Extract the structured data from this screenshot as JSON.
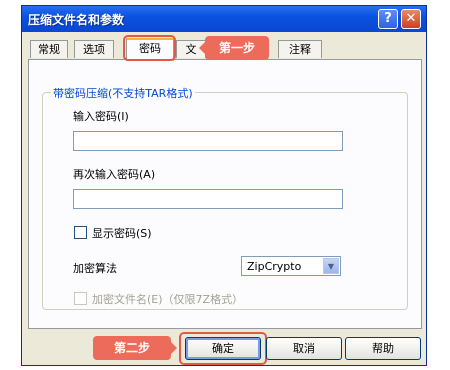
{
  "window": {
    "title": "压缩文件名和参数",
    "help_label": "?",
    "close_label": "✕"
  },
  "tabs": [
    {
      "label": "常规"
    },
    {
      "label": "选项"
    },
    {
      "label": "密码"
    },
    {
      "label": "文"
    },
    {
      "label": "注释"
    }
  ],
  "group": {
    "title": "带密码压缩(不支持TAR格式)",
    "password_label": "输入密码(I)",
    "password_value": "",
    "confirm_label": "再次输入密码(A)",
    "confirm_value": "",
    "show_password_label": "显示密码(S)",
    "algorithm_label": "加密算法",
    "algorithm_value": "ZipCrypto",
    "encrypt_names_label": "加密文件名(E)（仅限7Z格式）"
  },
  "buttons": {
    "ok": "确定",
    "cancel": "取消",
    "help": "帮助"
  },
  "callouts": {
    "step1": "第一步",
    "step2": "第二步"
  },
  "icons": {
    "dropdown": "chevron-down-icon",
    "help": "question-icon",
    "close": "close-icon"
  },
  "colors": {
    "titlebar": "#0a52e0",
    "callout": "#ec6b5a",
    "group_title": "#0046d5"
  }
}
